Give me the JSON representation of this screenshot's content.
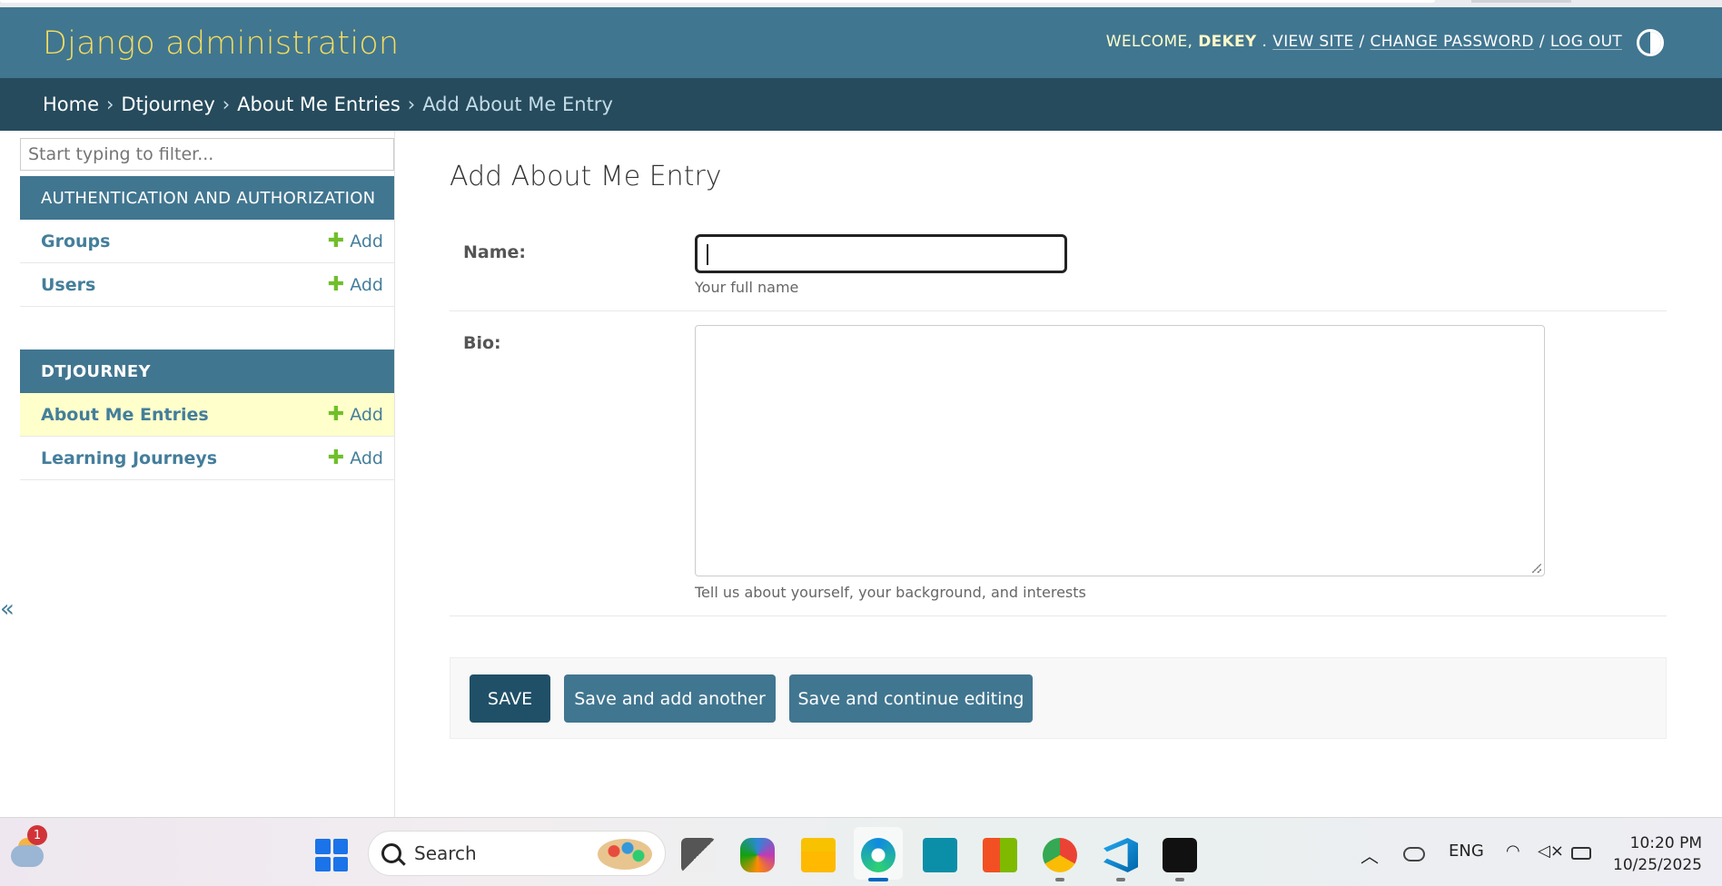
{
  "header": {
    "brand": "Django administration",
    "welcome": "Welcome,",
    "username": "dekey",
    "view_site": "View site",
    "change_password": "Change password",
    "log_out": "Log out",
    "separator": "/"
  },
  "breadcrumbs": {
    "home": "Home",
    "app": "Dtjourney",
    "model": "About Me Entries",
    "current": "Add About Me Entry",
    "separator": "›"
  },
  "sidebar": {
    "filter_placeholder": "Start typing to filter...",
    "collapse": "«",
    "modules": [
      {
        "caption": "Authentication and Authorization",
        "models": [
          {
            "name": "Groups",
            "add": "Add"
          },
          {
            "name": "Users",
            "add": "Add"
          }
        ]
      },
      {
        "caption": "Dtjourney",
        "models": [
          {
            "name": "About Me Entries",
            "add": "Add"
          },
          {
            "name": "Learning Journeys",
            "add": "Add"
          }
        ]
      }
    ]
  },
  "form": {
    "title": "Add About Me Entry",
    "name_label": "Name:",
    "name_value": "",
    "name_help": "Your full name",
    "bio_label": "Bio:",
    "bio_value": "",
    "bio_help": "Tell us about yourself, your background, and interests",
    "buttons": {
      "save": "Save",
      "save_add": "Save and add another",
      "save_continue": "Save and continue editing"
    }
  },
  "taskbar": {
    "notification_count": "1",
    "search": "Search",
    "lang": "ENG",
    "time": "10:20 PM",
    "date": "10/25/2025"
  },
  "colors": {
    "header": "#417690",
    "breadcrumbs": "#264b5d",
    "brand": "#f5dd5d",
    "link": "#447e9b",
    "add_plus": "#70bf2b",
    "save_default": "#205067",
    "active_row": "#ffffcc"
  }
}
